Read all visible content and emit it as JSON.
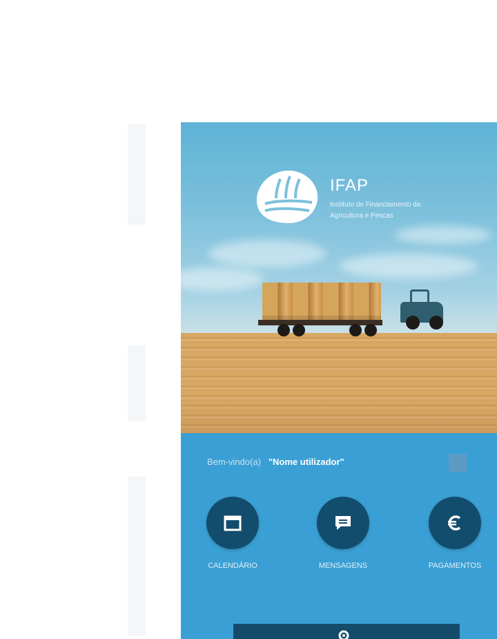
{
  "app": {
    "title": "IFAP",
    "subtitle": "Instituto de Financiamento da Agricultura e Pescas"
  },
  "panel": {
    "welcome_label": "Bem-vindo(a)",
    "user_name": "\"Nome utilizador\""
  },
  "actions": [
    {
      "label": "CALENDÁRIO",
      "icon": "calendar-icon"
    },
    {
      "label": "MENSAGENS",
      "icon": "message-icon"
    },
    {
      "label": "PAGAMENTOS",
      "icon": "euro-icon"
    }
  ],
  "bottom_button": {
    "label": "",
    "icon": "settings-icon"
  },
  "colors": {
    "panel": "#3a9fd4",
    "action_circle": "#134d6d",
    "bottom_button": "#154b6a"
  }
}
